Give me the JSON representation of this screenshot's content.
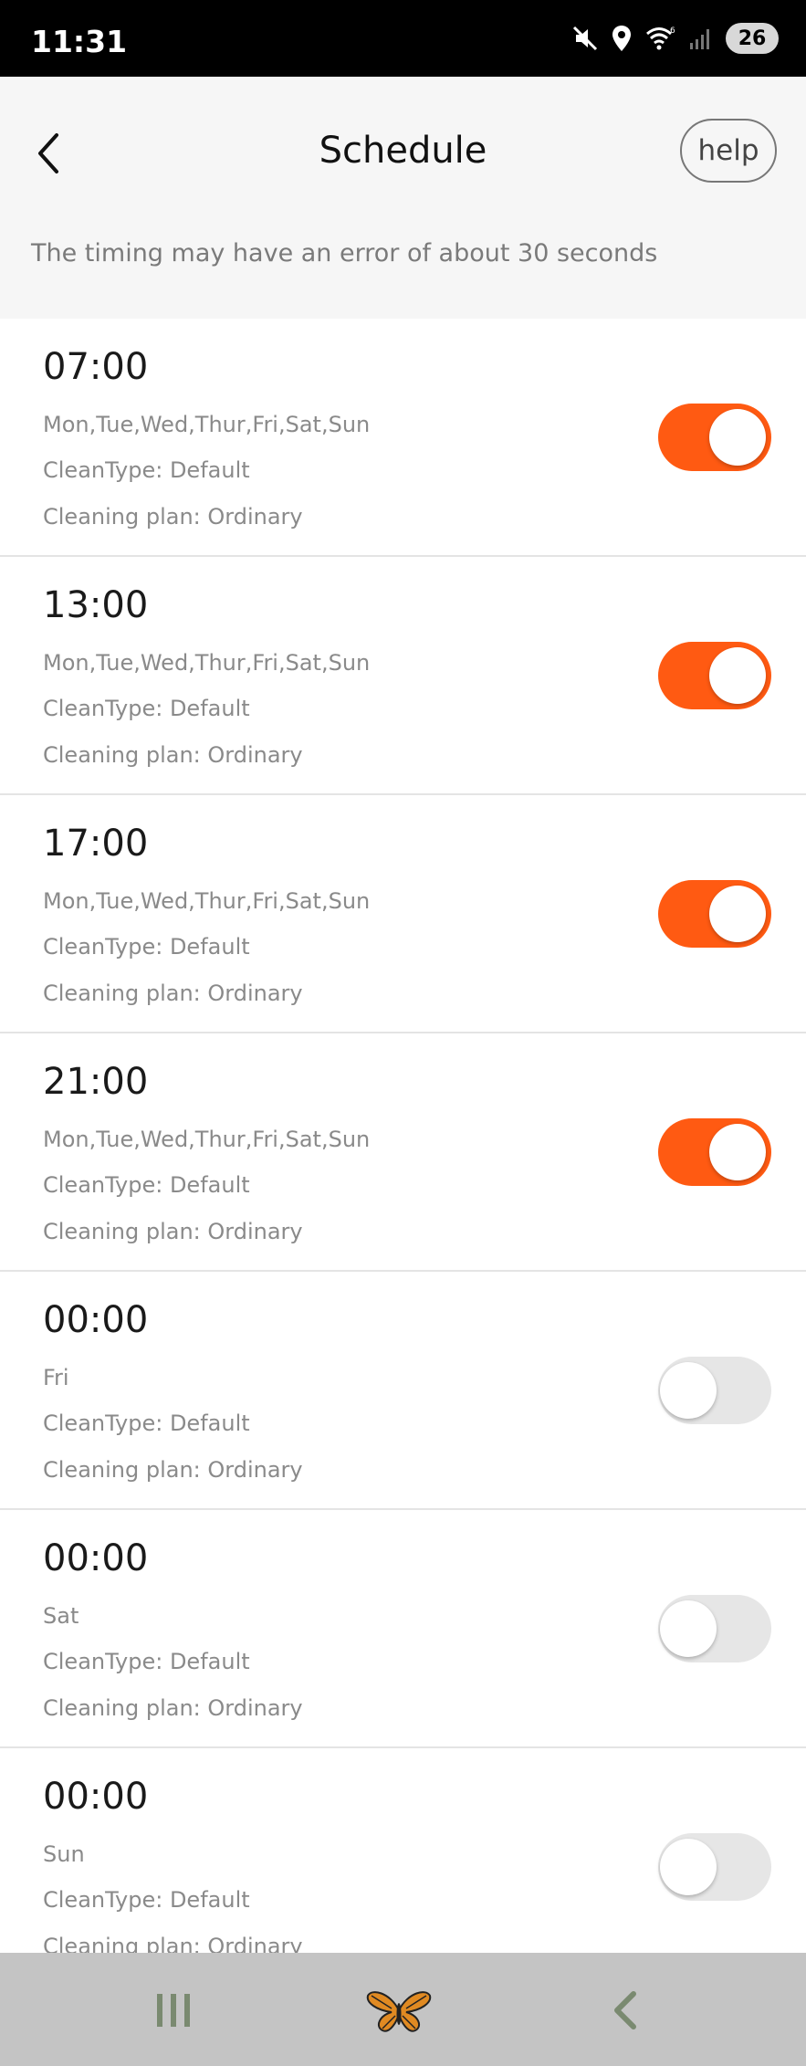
{
  "status_bar": {
    "time": "11:31",
    "battery_level": "26",
    "icons": [
      "mute-icon",
      "location-icon",
      "wifi-icon",
      "signal-icon",
      "battery-icon"
    ]
  },
  "header": {
    "title": "Schedule",
    "help_label": "help",
    "notice": "The timing may have an error of about 30 seconds"
  },
  "colors": {
    "accent": "#ff5a12",
    "toggle_off": "#e6e6e6",
    "header_bg": "#f6f6f6",
    "nav_bg": "#c4c4c4"
  },
  "schedules": [
    {
      "time": "07:00",
      "days": "Mon,Tue,Wed,Thur,Fri,Sat,Sun",
      "clean_type": "CleanType: Default",
      "plan": "Cleaning plan: Ordinary",
      "enabled": true
    },
    {
      "time": "13:00",
      "days": "Mon,Tue,Wed,Thur,Fri,Sat,Sun",
      "clean_type": "CleanType: Default",
      "plan": "Cleaning plan: Ordinary",
      "enabled": true
    },
    {
      "time": "17:00",
      "days": "Mon,Tue,Wed,Thur,Fri,Sat,Sun",
      "clean_type": "CleanType: Default",
      "plan": "Cleaning plan: Ordinary",
      "enabled": true
    },
    {
      "time": "21:00",
      "days": "Mon,Tue,Wed,Thur,Fri,Sat,Sun",
      "clean_type": "CleanType: Default",
      "plan": "Cleaning plan: Ordinary",
      "enabled": true
    },
    {
      "time": "00:00",
      "days": "Fri",
      "clean_type": "CleanType: Default",
      "plan": "Cleaning plan: Ordinary",
      "enabled": false
    },
    {
      "time": "00:00",
      "days": "Sat",
      "clean_type": "CleanType: Default",
      "plan": "Cleaning plan: Ordinary",
      "enabled": false
    },
    {
      "time": "00:00",
      "days": "Sun",
      "clean_type": "CleanType: Default",
      "plan": "Cleaning plan: Ordinary",
      "enabled": false
    }
  ],
  "nav_bar": {
    "icons": [
      "recents-icon",
      "butterfly-home-icon",
      "back-icon"
    ]
  }
}
